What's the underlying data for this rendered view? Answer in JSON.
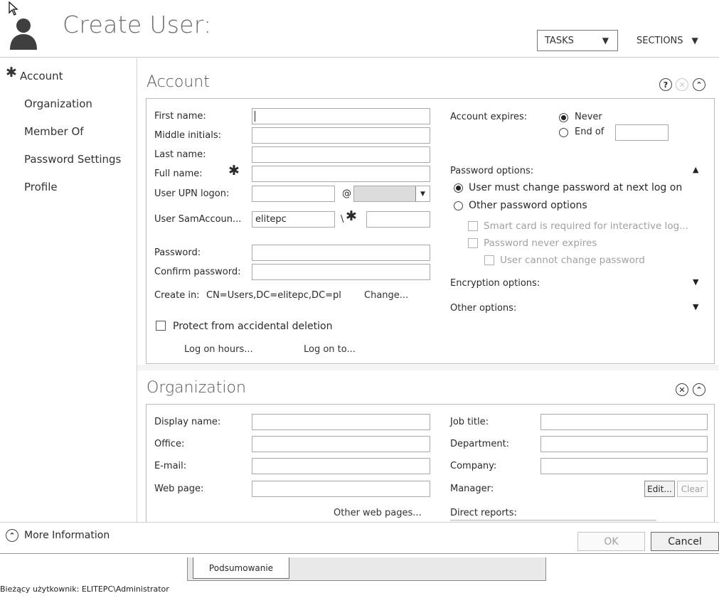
{
  "header": {
    "title": "Create User:",
    "tasks_label": "TASKS",
    "sections_label": "SECTIONS"
  },
  "nav": {
    "items": [
      {
        "label": "Account"
      },
      {
        "label": "Organization"
      },
      {
        "label": "Member Of"
      },
      {
        "label": "Password Settings"
      },
      {
        "label": "Profile"
      }
    ]
  },
  "account": {
    "title": "Account",
    "first_name_label": "First name:",
    "middle_initials_label": "Middle initials:",
    "last_name_label": "Last name:",
    "full_name_label": "Full name:",
    "upn_label": "User UPN logon:",
    "at_sign": "@",
    "sam_label": "User SamAccoun...",
    "sam_domain_value": "elitepc",
    "sam_sep": "\\",
    "password_label": "Password:",
    "confirm_password_label": "Confirm password:",
    "create_in_label": "Create in:",
    "create_in_value": "CN=Users,DC=elitepc,DC=pl",
    "change_link": "Change...",
    "protect_label": "Protect from accidental deletion",
    "log_on_hours_link": "Log on hours...",
    "log_on_to_link": "Log on to...",
    "account_expires_label": "Account expires:",
    "never_label": "Never",
    "end_of_label": "End of",
    "password_options_label": "Password options:",
    "must_change_label": "User must change password at next log on",
    "other_password_label": "Other password options",
    "smart_card_label": "Smart card is required for interactive log...",
    "never_expires_label": "Password never expires",
    "cannot_change_label": "User cannot change password",
    "encryption_label": "Encryption options:",
    "other_options_label": "Other options:"
  },
  "organization": {
    "title": "Organization",
    "display_name_label": "Display name:",
    "office_label": "Office:",
    "email_label": "E-mail:",
    "web_page_label": "Web page:",
    "other_web_pages_link": "Other web pages...",
    "job_title_label": "Job title:",
    "department_label": "Department:",
    "company_label": "Company:",
    "manager_label": "Manager:",
    "edit_button": "Edit...",
    "clear_button": "Clear",
    "direct_reports_label": "Direct reports:"
  },
  "footer": {
    "more_info_label": "More Information",
    "ok_button": "OK",
    "cancel_button": "Cancel"
  },
  "bottom": {
    "tab_label": "Podsumowanie",
    "status_text": "Bieżący użytkownik: ELITEPC\\Administrator"
  },
  "colors": {
    "border": "#b9b9b9",
    "text": "#2a2a2a",
    "muted": "#a0a0a0"
  }
}
